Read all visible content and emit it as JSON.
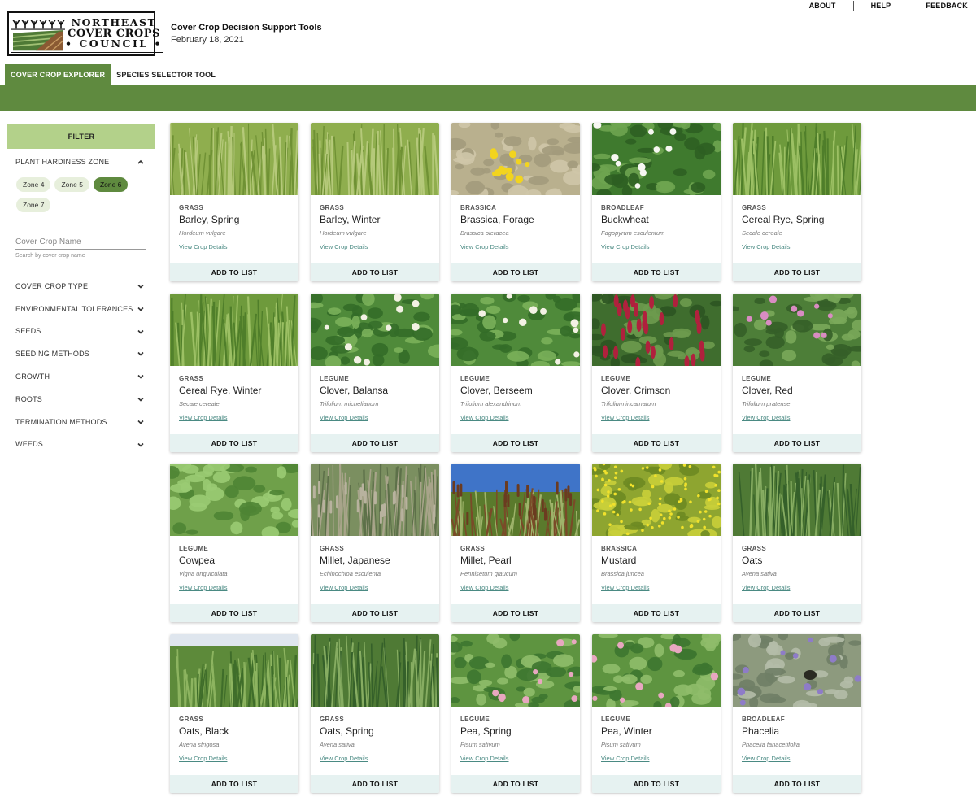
{
  "header": {
    "logo": {
      "line1": "NORTHEAST",
      "line2": "COVER CROPS",
      "line3": "• COUNCIL •"
    },
    "title": "Cover Crop Decision Support Tools",
    "date": "February 18, 2021",
    "nav": [
      "ABOUT",
      "HELP",
      "FEEDBACK"
    ]
  },
  "tabs": [
    {
      "label": "COVER CROP EXPLORER",
      "active": true
    },
    {
      "label": "SPECIES SELECTOR TOOL",
      "active": false
    }
  ],
  "sidebar": {
    "filter_label": "FILTER",
    "hardiness": {
      "label": "PLANT HARDINESS ZONE",
      "zones": [
        "Zone 4",
        "Zone 5",
        "Zone 6",
        "Zone 7"
      ],
      "selected": "Zone 6"
    },
    "search": {
      "placeholder": "Cover Crop Name",
      "helper": "Search by cover crop name"
    },
    "sections": [
      "COVER CROP TYPE",
      "ENVIRONMENTAL TOLERANCES",
      "SEEDS",
      "SEEDING METHODS",
      "GROWTH",
      "ROOTS",
      "TERMINATION METHODS",
      "WEEDS"
    ]
  },
  "card_labels": {
    "details": "View Crop Details",
    "add": "ADD TO LIST"
  },
  "colors": {
    "brand_green": "#5f8a3f",
    "filter_green": "#b3d18a",
    "link_teal": "#4a8a83",
    "button_bg": "#e6f2f1"
  },
  "crops": [
    {
      "category": "GRASS",
      "name": "Barley, Spring",
      "scientific": "Hordeum vulgare",
      "image": "grain"
    },
    {
      "category": "GRASS",
      "name": "Barley, Winter",
      "scientific": "Hordeum vulgare",
      "image": "grain"
    },
    {
      "category": "BRASSICA",
      "name": "Brassica, Forage",
      "scientific": "Brassica oleracea",
      "image": "yellowflower"
    },
    {
      "category": "BROADLEAF",
      "name": "Buckwheat",
      "scientific": "Fagopyrum esculentum",
      "image": "whiteflower"
    },
    {
      "category": "GRASS",
      "name": "Cereal Rye, Spring",
      "scientific": "Secale cereale",
      "image": "grass"
    },
    {
      "category": "GRASS",
      "name": "Cereal Rye, Winter",
      "scientific": "Secale cereale",
      "image": "grass"
    },
    {
      "category": "LEGUME",
      "name": "Clover, Balansa",
      "scientific": "Trifolium michelianum",
      "image": "clover"
    },
    {
      "category": "LEGUME",
      "name": "Clover, Berseem",
      "scientific": "Trifolium alexandrinum",
      "image": "clover"
    },
    {
      "category": "LEGUME",
      "name": "Clover, Crimson",
      "scientific": "Trifolium incarnatum",
      "image": "crimson"
    },
    {
      "category": "LEGUME",
      "name": "Clover, Red",
      "scientific": "Trifolium pratense",
      "image": "redclover"
    },
    {
      "category": "LEGUME",
      "name": "Cowpea",
      "scientific": "Vigna unguiculata",
      "image": "leaves"
    },
    {
      "category": "GRASS",
      "name": "Millet, Japanese",
      "scientific": "Echinochloa esculenta",
      "image": "millet"
    },
    {
      "category": "GRASS",
      "name": "Millet, Pearl",
      "scientific": "Pennisetum glaucum",
      "image": "pearl"
    },
    {
      "category": "BRASSICA",
      "name": "Mustard",
      "scientific": "Brassica juncea",
      "image": "mustard"
    },
    {
      "category": "GRASS",
      "name": "Oats",
      "scientific": "Avena sativa",
      "image": "oats"
    },
    {
      "category": "GRASS",
      "name": "Oats, Black",
      "scientific": "Avena strigosa",
      "image": "field"
    },
    {
      "category": "GRASS",
      "name": "Oats, Spring",
      "scientific": "Avena sativa",
      "image": "oats"
    },
    {
      "category": "LEGUME",
      "name": "Pea, Spring",
      "scientific": "Pisum sativum",
      "image": "pea"
    },
    {
      "category": "LEGUME",
      "name": "Pea, Winter",
      "scientific": "Pisum sativum",
      "image": "pea"
    },
    {
      "category": "BROADLEAF",
      "name": "Phacelia",
      "scientific": "Phacelia tanacetifolia",
      "image": "phacelia"
    }
  ]
}
